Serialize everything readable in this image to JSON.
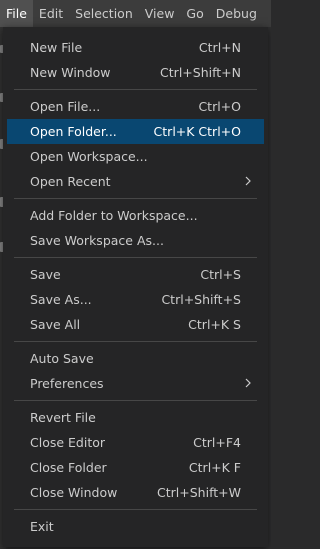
{
  "menubar": {
    "items": [
      {
        "label": "File",
        "active": true
      },
      {
        "label": "Edit",
        "active": false
      },
      {
        "label": "Selection",
        "active": false
      },
      {
        "label": "View",
        "active": false
      },
      {
        "label": "Go",
        "active": false
      },
      {
        "label": "Debug",
        "active": false
      }
    ]
  },
  "file_menu": {
    "groups": [
      [
        {
          "label": "New File",
          "shortcut": "Ctrl+N"
        },
        {
          "label": "New Window",
          "shortcut": "Ctrl+Shift+N"
        }
      ],
      [
        {
          "label": "Open File...",
          "shortcut": "Ctrl+O"
        },
        {
          "label": "Open Folder...",
          "shortcut": "Ctrl+K Ctrl+O",
          "highlighted": true
        },
        {
          "label": "Open Workspace...",
          "shortcut": ""
        },
        {
          "label": "Open Recent",
          "shortcut": "",
          "submenu": true
        }
      ],
      [
        {
          "label": "Add Folder to Workspace...",
          "shortcut": ""
        },
        {
          "label": "Save Workspace As...",
          "shortcut": ""
        }
      ],
      [
        {
          "label": "Save",
          "shortcut": "Ctrl+S"
        },
        {
          "label": "Save As...",
          "shortcut": "Ctrl+Shift+S"
        },
        {
          "label": "Save All",
          "shortcut": "Ctrl+K S"
        }
      ],
      [
        {
          "label": "Auto Save",
          "shortcut": ""
        },
        {
          "label": "Preferences",
          "shortcut": "",
          "submenu": true
        }
      ],
      [
        {
          "label": "Revert File",
          "shortcut": ""
        },
        {
          "label": "Close Editor",
          "shortcut": "Ctrl+F4"
        },
        {
          "label": "Close Folder",
          "shortcut": "Ctrl+K F"
        },
        {
          "label": "Close Window",
          "shortcut": "Ctrl+Shift+W"
        }
      ],
      [
        {
          "label": "Exit",
          "shortcut": ""
        }
      ]
    ]
  },
  "icons": {
    "submenu": "chevron-right-icon"
  },
  "colors": {
    "menubar_bg": "#3c3c3c",
    "menu_bg": "#252526",
    "highlight_bg": "#094771",
    "text": "#cccccc",
    "separator": "#474747"
  }
}
